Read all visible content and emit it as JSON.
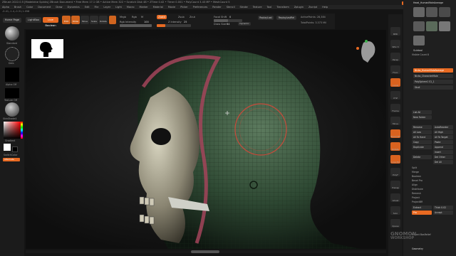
{
  "titlebar": {
    "text": "ZBrush 2022.0.5 [Madeleine Spinks] ZBrush Document  • Free Mem 17.1 GB • Active Mem 322 • Scratch Disk 48 • ZTime 0.42 • Timer 0.001 • PolyCount 3.43 MP • MeshCount 5",
    "menus_label": "Menus",
    "ui_label": "DefaultZScript",
    "quicksave": "QuickSave",
    "seethrough": "See-through 0"
  },
  "menubar": [
    "Alpha",
    "Brush",
    "Color",
    "Document",
    "Draw",
    "Dynamics",
    "Edit",
    "File",
    "Layer",
    "Light",
    "Macro",
    "Marker",
    "Material",
    "Movie",
    "Picker",
    "Preferences",
    "Render",
    "Stencil",
    "Stroke",
    "Texture",
    "Tool",
    "Transform",
    "Zplugin",
    "Zscript",
    "Help"
  ],
  "coords": "-0.41,-1.4,-0.31,1.058",
  "toolbar": {
    "tabs": [
      "Home Page",
      "LightBox",
      "Live Boolean"
    ],
    "icons": [
      "Edit",
      "Draw",
      "Move",
      "Scale",
      "Rotate"
    ],
    "mrgb": "Mrgb",
    "rgb": "Rgb",
    "m": "M",
    "zadd": "Zadd",
    "zsub": "Zsub",
    "zcut": "Zcut",
    "rgb_intensity_label": "Rgb Intensity",
    "rgb_intensity_value": "100",
    "z_intensity_label": "Z Intensity",
    "z_intensity_value": "25",
    "focal_shift_label": "Focal Shift",
    "focal_shift_value": "0",
    "draw_size_label": "Draw Size",
    "draw_size_value": "64",
    "dynamic_label": "Dynamic",
    "replay_last": "ReplayLast",
    "replay_last_rel": "ReplayLastRel",
    "active_points": "ActivePoints: 28,384",
    "total_points": "TotalPoints: 3.373 Mil"
  },
  "leftshelf": {
    "home_page": "Home Page",
    "standard": "Standard",
    "dots": "Dots",
    "alpha_off": "Alpha Off",
    "texture_off": "Texture Off",
    "material": "SkinShade4",
    "gradient": "Gradient",
    "switch_color": "SwitchColor",
    "alternate": "Alternate"
  },
  "rightstrip": [
    "BPR",
    "SPix 3",
    "Persp",
    "Floor",
    "Local",
    "XYZ",
    "Frame",
    "Move",
    "Zoom3D",
    "Rotate",
    "Line Fill",
    "PolyF",
    "Transp",
    "Ghost",
    "Solo",
    "Xpose"
  ],
  "rightpanel": {
    "top_label": "Head_HumanMaleAverage",
    "subtool_title": "Subtool",
    "visible_count": "Visible Count 8",
    "items": [
      "Nicko_HumanMaleAverage",
      "Nicko_CharacterMale",
      "PolySphere1 S1_1",
      "Skull"
    ],
    "buttons": [
      "List All",
      "New Folder",
      "Rename",
      "AutoReorder",
      "All Low",
      "All High",
      "All To Hand",
      "All To Target",
      "Copy",
      "Paste",
      "Duplicate",
      "Append",
      "Insert",
      "Delete",
      "Del Other",
      "Del All",
      "Split",
      "Merge",
      "Boolean",
      "Bevel Pro",
      "Align",
      "Distribute",
      "Remesh",
      "Project",
      "ProjectBR",
      "Extract",
      "Geometry",
      "Layers",
      "FiberMesh",
      "Geometry HD",
      "Preview",
      "Surface",
      "Deformation",
      "Masking",
      "Visibility",
      "Polygroups",
      "Contact",
      "Morph Target"
    ],
    "geometry_label": "Geometry",
    "project_bas_relief": "Project BasRelief",
    "extract_label": "Extract",
    "pro_label": "Pro",
    "thick_label": "Thick 0.02",
    "accept_label": "Accept"
  },
  "watermark": {
    "line1": "GNOMON",
    "line2": "WORKSHOP"
  },
  "colors": {
    "accent": "#e86a22",
    "bg": "#141414",
    "panel": "#1f1f1f"
  }
}
